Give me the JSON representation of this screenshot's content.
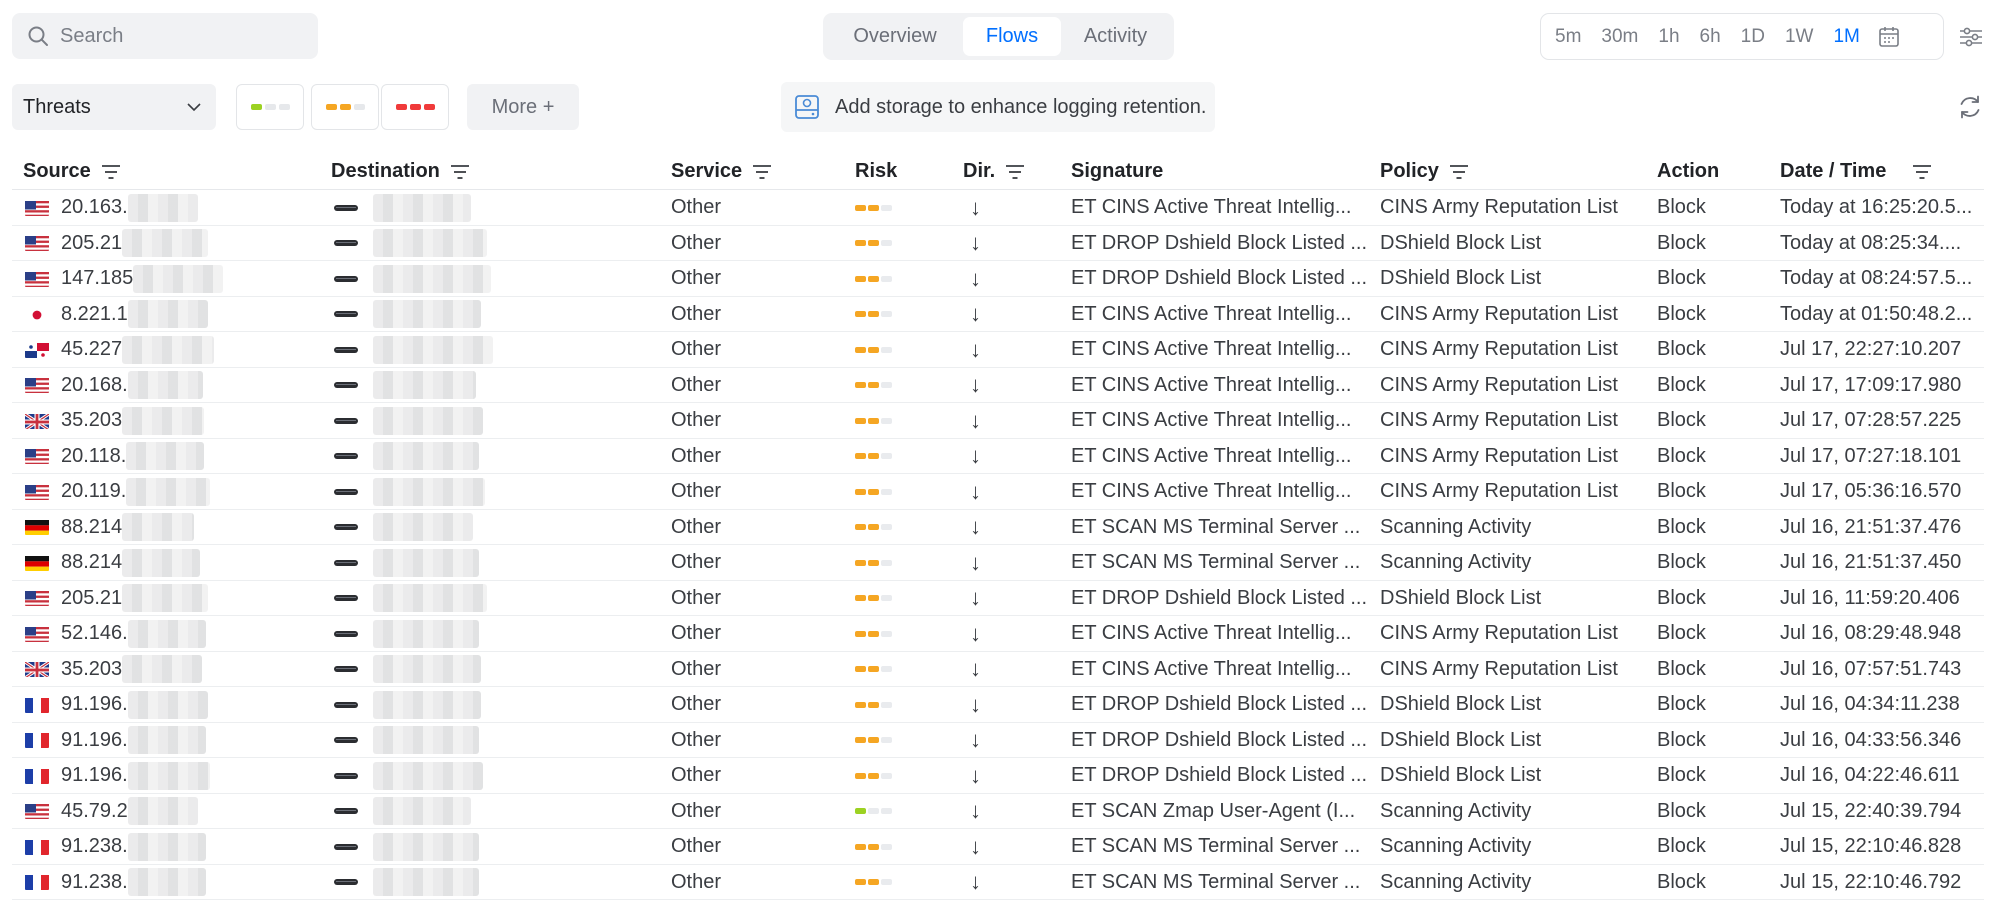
{
  "search": {
    "placeholder": "Search"
  },
  "view_tabs": [
    {
      "label": "Overview",
      "active": false
    },
    {
      "label": "Flows",
      "active": true
    },
    {
      "label": "Activity",
      "active": false
    }
  ],
  "time_ranges": [
    {
      "label": "5m",
      "active": false
    },
    {
      "label": "30m",
      "active": false
    },
    {
      "label": "1h",
      "active": false
    },
    {
      "label": "6h",
      "active": false
    },
    {
      "label": "1D",
      "active": false
    },
    {
      "label": "1W",
      "active": false
    },
    {
      "label": "1M",
      "active": true
    }
  ],
  "icons": {
    "search": "search-icon",
    "calendar": "calendar-icon",
    "settings": "settings-sliders-icon",
    "chevron": "chevron-down-icon",
    "storage": "hard-drive-icon",
    "refresh": "refresh-icon",
    "filter": "filter-lines-icon",
    "device": "gateway-device-icon"
  },
  "filters": {
    "category_select": "Threats",
    "risk_levels": [
      "low",
      "medium",
      "high"
    ],
    "more_label": "More +"
  },
  "banner": {
    "text": "Add storage to enhance logging retention."
  },
  "colors": {
    "accent": "#006fff",
    "risk_low": "#9cd222",
    "risk_medium": "#f5a623",
    "risk_high": "#f03a3a",
    "risk_empty": "#e6e8eb"
  },
  "table": {
    "columns": [
      "Source",
      "Destination",
      "Service",
      "Risk",
      "Dir.",
      "Signature",
      "Policy",
      "Action",
      "Date / Time"
    ],
    "rows": [
      {
        "flag": "us",
        "source": "20.163.",
        "service": "Other",
        "risk": "medium",
        "dir": "↓",
        "signature": "ET CINS Active Threat Intellig...",
        "policy": "CINS Army Reputation List",
        "action": "Block",
        "datetime": "Today at 16:25:20.5..."
      },
      {
        "flag": "us",
        "source": "205.21",
        "service": "Other",
        "risk": "medium",
        "dir": "↓",
        "signature": "ET DROP Dshield Block Listed ...",
        "policy": "DShield Block List",
        "action": "Block",
        "datetime": "Today at 08:25:34...."
      },
      {
        "flag": "us",
        "source": "147.185",
        "service": "Other",
        "risk": "medium",
        "dir": "↓",
        "signature": "ET DROP Dshield Block Listed ...",
        "policy": "DShield Block List",
        "action": "Block",
        "datetime": "Today at 08:24:57.5..."
      },
      {
        "flag": "jp",
        "source": "8.221.1",
        "service": "Other",
        "risk": "medium",
        "dir": "↓",
        "signature": "ET CINS Active Threat Intellig...",
        "policy": "CINS Army Reputation List",
        "action": "Block",
        "datetime": "Today at 01:50:48.2..."
      },
      {
        "flag": "pa",
        "source": "45.227",
        "service": "Other",
        "risk": "medium",
        "dir": "↓",
        "signature": "ET CINS Active Threat Intellig...",
        "policy": "CINS Army Reputation List",
        "action": "Block",
        "datetime": "Jul 17, 22:27:10.207"
      },
      {
        "flag": "us",
        "source": "20.168.",
        "service": "Other",
        "risk": "medium",
        "dir": "↓",
        "signature": "ET CINS Active Threat Intellig...",
        "policy": "CINS Army Reputation List",
        "action": "Block",
        "datetime": "Jul 17, 17:09:17.980"
      },
      {
        "flag": "gb",
        "source": "35.203",
        "service": "Other",
        "risk": "medium",
        "dir": "↓",
        "signature": "ET CINS Active Threat Intellig...",
        "policy": "CINS Army Reputation List",
        "action": "Block",
        "datetime": "Jul 17, 07:28:57.225"
      },
      {
        "flag": "us",
        "source": "20.118.",
        "service": "Other",
        "risk": "medium",
        "dir": "↓",
        "signature": "ET CINS Active Threat Intellig...",
        "policy": "CINS Army Reputation List",
        "action": "Block",
        "datetime": "Jul 17, 07:27:18.101"
      },
      {
        "flag": "us",
        "source": "20.119.",
        "service": "Other",
        "risk": "medium",
        "dir": "↓",
        "signature": "ET CINS Active Threat Intellig...",
        "policy": "CINS Army Reputation List",
        "action": "Block",
        "datetime": "Jul 17, 05:36:16.570"
      },
      {
        "flag": "de",
        "source": "88.214",
        "service": "Other",
        "risk": "medium",
        "dir": "↓",
        "signature": "ET SCAN MS Terminal Server ...",
        "policy": "Scanning Activity",
        "action": "Block",
        "datetime": "Jul 16, 21:51:37.476"
      },
      {
        "flag": "de",
        "source": "88.214",
        "service": "Other",
        "risk": "medium",
        "dir": "↓",
        "signature": "ET SCAN MS Terminal Server ...",
        "policy": "Scanning Activity",
        "action": "Block",
        "datetime": "Jul 16, 21:51:37.450"
      },
      {
        "flag": "us",
        "source": "205.21",
        "service": "Other",
        "risk": "medium",
        "dir": "↓",
        "signature": "ET DROP Dshield Block Listed ...",
        "policy": "DShield Block List",
        "action": "Block",
        "datetime": "Jul 16, 11:59:20.406"
      },
      {
        "flag": "us",
        "source": "52.146.",
        "service": "Other",
        "risk": "medium",
        "dir": "↓",
        "signature": "ET CINS Active Threat Intellig...",
        "policy": "CINS Army Reputation List",
        "action": "Block",
        "datetime": "Jul 16, 08:29:48.948"
      },
      {
        "flag": "gb",
        "source": "35.203",
        "service": "Other",
        "risk": "medium",
        "dir": "↓",
        "signature": "ET CINS Active Threat Intellig...",
        "policy": "CINS Army Reputation List",
        "action": "Block",
        "datetime": "Jul 16, 07:57:51.743"
      },
      {
        "flag": "fr",
        "source": "91.196.",
        "service": "Other",
        "risk": "medium",
        "dir": "↓",
        "signature": "ET DROP Dshield Block Listed ...",
        "policy": "DShield Block List",
        "action": "Block",
        "datetime": "Jul 16, 04:34:11.238"
      },
      {
        "flag": "fr",
        "source": "91.196.",
        "service": "Other",
        "risk": "medium",
        "dir": "↓",
        "signature": "ET DROP Dshield Block Listed ...",
        "policy": "DShield Block List",
        "action": "Block",
        "datetime": "Jul 16, 04:33:56.346"
      },
      {
        "flag": "fr",
        "source": "91.196.",
        "service": "Other",
        "risk": "medium",
        "dir": "↓",
        "signature": "ET DROP Dshield Block Listed ...",
        "policy": "DShield Block List",
        "action": "Block",
        "datetime": "Jul 16, 04:22:46.611"
      },
      {
        "flag": "us",
        "source": "45.79.2",
        "service": "Other",
        "risk": "low",
        "dir": "↓",
        "signature": "ET SCAN Zmap User-Agent (I...",
        "policy": "Scanning Activity",
        "action": "Block",
        "datetime": "Jul 15, 22:40:39.794"
      },
      {
        "flag": "fr",
        "source": "91.238.",
        "service": "Other",
        "risk": "medium",
        "dir": "↓",
        "signature": "ET SCAN MS Terminal Server ...",
        "policy": "Scanning Activity",
        "action": "Block",
        "datetime": "Jul 15, 22:10:46.828"
      },
      {
        "flag": "fr",
        "source": "91.238.",
        "service": "Other",
        "risk": "medium",
        "dir": "↓",
        "signature": "ET SCAN MS Terminal Server ...",
        "policy": "Scanning Activity",
        "action": "Block",
        "datetime": "Jul 15, 22:10:46.792"
      }
    ]
  }
}
